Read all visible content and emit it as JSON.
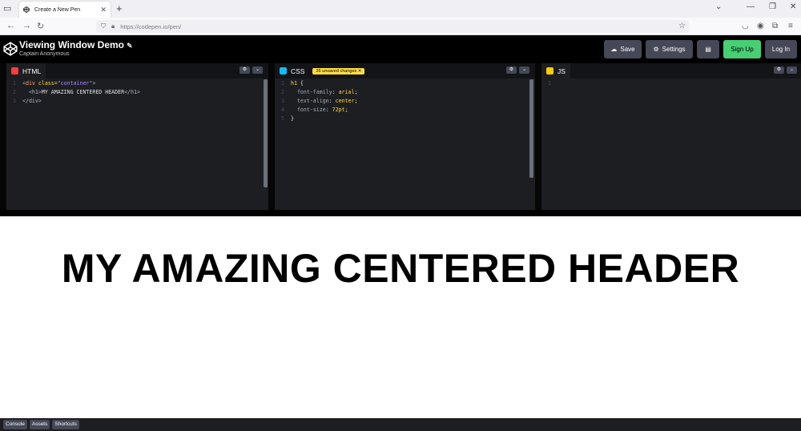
{
  "browser": {
    "tab_title": "Create a New Pen",
    "url": "https://codepen.io/pen/"
  },
  "header": {
    "pen_title": "Viewing Window Demo",
    "author": "Captain Anonymous",
    "buttons": {
      "save": "Save",
      "settings": "Settings",
      "signup": "Sign Up",
      "login": "Log In"
    }
  },
  "editors": {
    "html": {
      "label": "HTML"
    },
    "css": {
      "label": "CSS",
      "unsaved_badge": "26 unsaved changes"
    },
    "js": {
      "label": "JS"
    }
  },
  "code": {
    "html_lines": [
      {
        "ln": "1",
        "t1": "<",
        "tag": "div",
        "attr": " class=",
        "str": "\"container\"",
        "t2": ">"
      },
      {
        "ln": "2",
        "open": "<h1>",
        "text": "MY AMAZING CENTERED HEADER",
        "close": "</h1>"
      },
      {
        "ln": "3",
        "line": "</div>"
      }
    ],
    "css_lines": [
      {
        "ln": "1",
        "sel": "h1",
        "brace": " {"
      },
      {
        "ln": "2",
        "prop": "font-family",
        "val": "arial"
      },
      {
        "ln": "3",
        "prop": "text-align",
        "val": "center"
      },
      {
        "ln": "4",
        "prop": "font-size",
        "val": "72pt"
      },
      {
        "ln": "5",
        "brace": "}"
      }
    ],
    "js_lines": [
      {
        "ln": "1"
      }
    ]
  },
  "preview": {
    "heading": "MY AMAZING CENTERED HEADER"
  },
  "bottom_bar": {
    "console": "Console",
    "assets": "Assets",
    "shortcuts": "Shortcuts"
  },
  "colors": {
    "signup_green": "#47cf73",
    "html_icon": "#ff3c41",
    "css_icon": "#0ebeff",
    "js_icon": "#fcd000",
    "badge_yellow": "#ffdd40"
  }
}
